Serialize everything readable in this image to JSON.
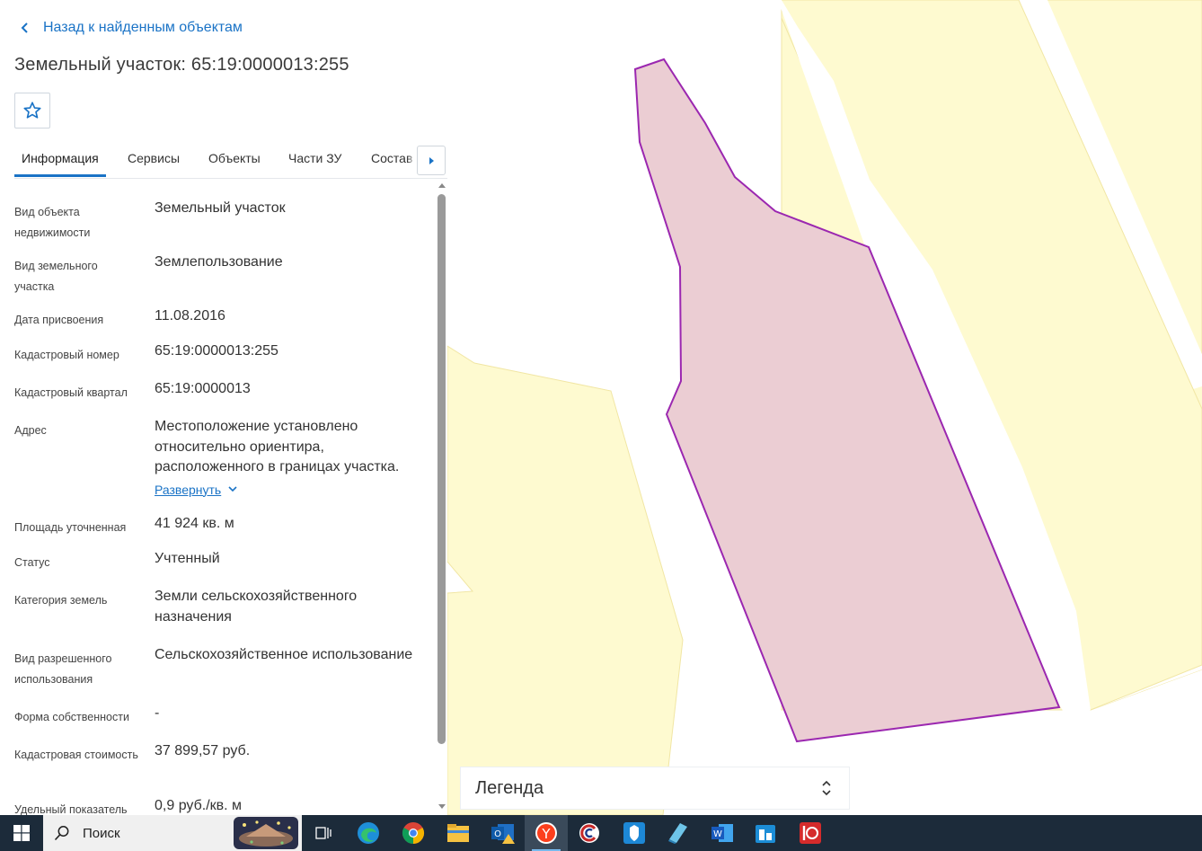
{
  "header": {
    "back_label": "Назад к найденным объектам",
    "title": "Земельный участок: 65:19:0000013:255"
  },
  "tabs": [
    {
      "label": "Информация",
      "active": true
    },
    {
      "label": "Сервисы",
      "active": false
    },
    {
      "label": "Объекты",
      "active": false
    },
    {
      "label": "Части ЗУ",
      "active": false
    },
    {
      "label": "Состав",
      "active": false
    }
  ],
  "info": {
    "object_type": {
      "label": "Вид объекта недвижимости",
      "value": "Земельный участок"
    },
    "land_type": {
      "label": "Вид земельного участка",
      "value": "Землепользование"
    },
    "assign_date": {
      "label": "Дата присвоения",
      "value": "11.08.2016"
    },
    "cad_number": {
      "label": "Кадастровый номер",
      "value": "65:19:0000013:255"
    },
    "cad_quarter": {
      "label": "Кадастровый квартал",
      "value": "65:19:0000013"
    },
    "address": {
      "label": "Адрес",
      "value": "Местоположение установлено относительно ориентира, расположенного в границах участка.",
      "expand_label": "Развернуть"
    },
    "area": {
      "label": "Площадь уточненная",
      "value": "41 924 кв. м"
    },
    "status": {
      "label": "Статус",
      "value": "Учтенный"
    },
    "land_category": {
      "label": "Категория земель",
      "value": "Земли сельскохозяйственного назначения"
    },
    "permitted_use": {
      "label": "Вид разрешенного использования",
      "value": "Сельскохозяйственное использование"
    },
    "ownership": {
      "label": "Форма собственности",
      "value": "-"
    },
    "cad_value": {
      "label": "Кадастровая стоимость",
      "value": "37 899,57 руб."
    },
    "unit_value": {
      "label": "Удельный показатель",
      "value": "0,9 руб./кв. м"
    }
  },
  "legend": {
    "label": "Легенда"
  },
  "colors": {
    "accent": "#1a73c6",
    "parcel_fill": "#ebcdd3",
    "parcel_stroke": "#9b27b0",
    "plot_fill": "#fefad0",
    "plot_stroke": "#f1e6a4"
  },
  "taskbar": {
    "search_placeholder": "Поиск",
    "apps": [
      "windows-start-icon",
      "task-view-icon",
      "edge-icon",
      "chrome-icon",
      "file-explorer-icon",
      "outlook-icon",
      "yandex-browser-icon",
      "consultant-icon",
      "rosreestr-icon",
      "notepad-icon",
      "word-icon",
      "store-icon",
      "app-red-icon"
    ]
  }
}
